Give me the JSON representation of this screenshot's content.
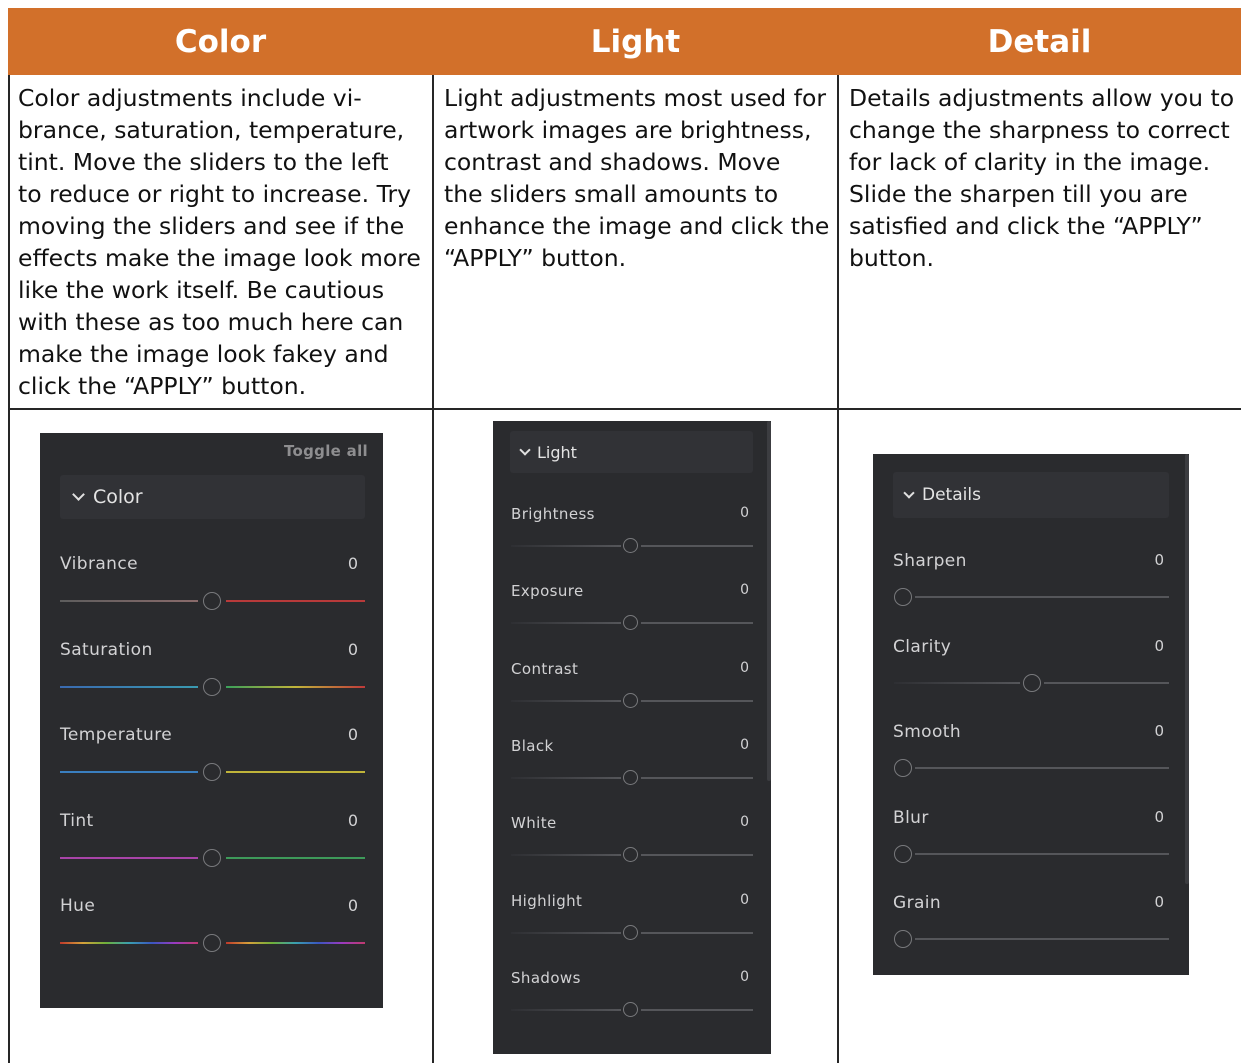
{
  "headers": [
    "Color",
    "Light",
    "Detail"
  ],
  "descriptions": {
    "color": "Color adjustments include vi-\nbrance, saturation, temperature,\ntint.  Move the sliders to the left\nto reduce or right to increase.  Try\nmoving the sliders and see if the\neffects make the image look more\nlike the work itself.  Be cautious\nwith these as too much here can\nmake the image look fakey and\nclick the “APPLY” button.",
    "light": "Light adjustments most used for\nartwork images are brightness,\ncontrast and shadows.  Move\nthe sliders small amounts to\nenhance the image and click the\n“APPLY” button.",
    "detail": "Details adjustments allow you to\nchange the sharpness to correct\nfor lack of clarity in the image.\nSlide the sharpen till you are\nsatisfied and click the “APPLY”\nbutton."
  },
  "color_panel": {
    "toggle_all": "Toggle all",
    "title": "Color",
    "sliders": [
      {
        "label": "Vibrance",
        "value": "0",
        "left_color": "#6e6e6e",
        "right_color": "#b83a3a"
      },
      {
        "label": "Saturation",
        "value": "0",
        "left_color": "#3f7fb0",
        "right_color": "gradient"
      },
      {
        "label": "Temperature",
        "value": "0",
        "left_color": "#3a7fc0",
        "right_color": "#c0b43a"
      },
      {
        "label": "Tint",
        "value": "0",
        "left_color": "#a844a8",
        "right_color": "#3e9a5a"
      },
      {
        "label": "Hue",
        "value": "0",
        "left_color": "rainbow",
        "right_color": "rainbow"
      }
    ]
  },
  "light_panel": {
    "title": "Light",
    "sliders": [
      {
        "label": "Brightness",
        "value": "0"
      },
      {
        "label": "Exposure",
        "value": "0"
      },
      {
        "label": "Contrast",
        "value": "0"
      },
      {
        "label": "Black",
        "value": "0"
      },
      {
        "label": "White",
        "value": "0"
      },
      {
        "label": "Highlight",
        "value": "0"
      },
      {
        "label": "Shadows",
        "value": "0"
      }
    ]
  },
  "details_panel": {
    "title": "Details",
    "sliders": [
      {
        "label": "Sharpen",
        "value": "0",
        "position": 0
      },
      {
        "label": "Clarity",
        "value": "0",
        "position": 0.5
      },
      {
        "label": "Smooth",
        "value": "0",
        "position": 0
      },
      {
        "label": "Blur",
        "value": "0",
        "position": 0
      },
      {
        "label": "Grain",
        "value": "0",
        "position": 0
      }
    ]
  }
}
